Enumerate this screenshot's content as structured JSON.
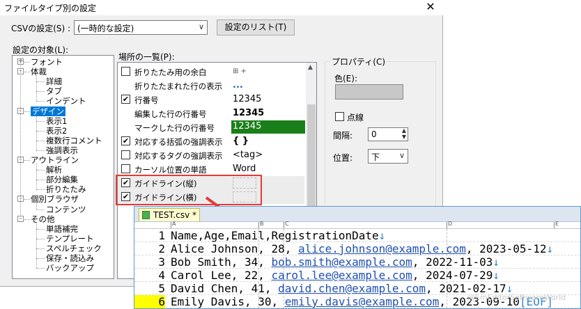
{
  "dialog": {
    "title": "ファイルタイプ別の設定",
    "close_glyph": "✕",
    "csv_settings_label": "CSVの設定(S) :",
    "csv_settings_value": "(一時的な設定)",
    "settings_list_button": "設定のリスト(T)",
    "target_label": "設定の対象(L):",
    "places_label": "場所の一覧(P):",
    "property_label": "プロパティ(C)",
    "color_label": "色(E):",
    "dotted_label": "点線",
    "spacing_label": "間隔:",
    "spacing_value": "0",
    "position_label": "位置:",
    "position_value": "下"
  },
  "tree": [
    {
      "label": "フォント",
      "indent": 0,
      "expander": "+",
      "selected": false
    },
    {
      "label": "体裁",
      "indent": 0,
      "expander": "-",
      "selected": false
    },
    {
      "label": "詳細",
      "indent": 1,
      "expander": "",
      "selected": false
    },
    {
      "label": "タブ",
      "indent": 1,
      "expander": "",
      "selected": false
    },
    {
      "label": "インデント",
      "indent": 1,
      "expander": "",
      "selected": false
    },
    {
      "label": "デザイン",
      "indent": 0,
      "expander": "-",
      "selected": true
    },
    {
      "label": "表示1",
      "indent": 1,
      "expander": "",
      "selected": false
    },
    {
      "label": "表示2",
      "indent": 1,
      "expander": "",
      "selected": false
    },
    {
      "label": "複数行コメント",
      "indent": 1,
      "expander": "",
      "selected": false
    },
    {
      "label": "強調表示",
      "indent": 1,
      "expander": "",
      "selected": false
    },
    {
      "label": "アウトライン",
      "indent": 0,
      "expander": "-",
      "selected": false
    },
    {
      "label": "解析",
      "indent": 1,
      "expander": "",
      "selected": false
    },
    {
      "label": "部分編集",
      "indent": 1,
      "expander": "",
      "selected": false
    },
    {
      "label": "折りたたみ",
      "indent": 1,
      "expander": "",
      "selected": false
    },
    {
      "label": "個別ブラウザ",
      "indent": 0,
      "expander": "-",
      "selected": false
    },
    {
      "label": "コンテンツ",
      "indent": 1,
      "expander": "",
      "selected": false
    },
    {
      "label": "その他",
      "indent": 0,
      "expander": "-",
      "selected": false
    },
    {
      "label": "単語補完",
      "indent": 1,
      "expander": "",
      "selected": false
    },
    {
      "label": "テンプレート",
      "indent": 1,
      "expander": "",
      "selected": false
    },
    {
      "label": "スペルチェック",
      "indent": 1,
      "expander": "",
      "selected": false
    },
    {
      "label": "保存・読込み",
      "indent": 1,
      "expander": "",
      "selected": false
    },
    {
      "label": "バックアップ",
      "indent": 1,
      "expander": "",
      "selected": false
    }
  ],
  "places": [
    {
      "checkbox": true,
      "checked": false,
      "label": "折りたたみ用の余白",
      "sample": "⊞ +",
      "style": "small"
    },
    {
      "checkbox": false,
      "checked": false,
      "label": "折りたたまれた行の表示",
      "sample": "...",
      "style": "dots"
    },
    {
      "checkbox": true,
      "checked": true,
      "label": "行番号",
      "sample": "12345",
      "style": "plain"
    },
    {
      "checkbox": false,
      "checked": false,
      "label": "編集した行の行番号",
      "sample": "12345",
      "style": "bold"
    },
    {
      "checkbox": false,
      "checked": false,
      "label": "マークした行の行番号",
      "sample": "12345",
      "style": "green"
    },
    {
      "checkbox": true,
      "checked": true,
      "label": "対応する括弧の強調表示",
      "sample": "{ }",
      "style": "bold"
    },
    {
      "checkbox": true,
      "checked": false,
      "label": "対応するタグの強調表示",
      "sample": "<tag>",
      "style": "plain"
    },
    {
      "checkbox": true,
      "checked": false,
      "label": "カーソル位置の単語",
      "sample": "Word",
      "style": "plain"
    },
    {
      "checkbox": true,
      "checked": true,
      "label": "ガイドライン(縦)",
      "sample": "",
      "style": "vguide"
    },
    {
      "checkbox": true,
      "checked": true,
      "label": "ガイドライン(横)",
      "sample": "",
      "style": "hguide"
    }
  ],
  "editor": {
    "tab_label": "TEST.csv *",
    "column_letters": [
      "A",
      "B",
      "C",
      "D",
      "E"
    ],
    "lines": [
      {
        "num": "1",
        "name": "Name",
        "age": "Age",
        "email": "Email",
        "date": "RegistrationDate",
        "eol": "↓",
        "current": false
      },
      {
        "num": "2",
        "name": "Alice Johnson",
        "age": "28",
        "email": "alice.johnson@example.com",
        "date": "2023-05-12",
        "eol": "↓",
        "current": false
      },
      {
        "num": "3",
        "name": "Bob Smith",
        "age": "34",
        "email": "bob.smith@example.com",
        "date": "2022-11-03",
        "eol": "↓",
        "current": false
      },
      {
        "num": "4",
        "name": "Carol Lee",
        "age": "22",
        "email": "carol.lee@example.com",
        "date": "2024-07-29",
        "eol": "↓",
        "current": false
      },
      {
        "num": "5",
        "name": "David Chen",
        "age": "41",
        "email": "david.chen@example.com",
        "date": "2021-02-17",
        "eol": "↓",
        "current": false
      },
      {
        "num": "6",
        "name": "Emily Davis",
        "age": "30",
        "email": "emily.davis@example.com",
        "date": "2023-09-10",
        "eol": "[EOF]",
        "current": true
      }
    ],
    "watermark": "@EmEditorSoftwareWorld"
  },
  "colors": {
    "highlight": "#e53935",
    "selection": "#0078d7",
    "marked_line_bg": "#1a7f1a",
    "current_line_num_bg": "#ffff00"
  }
}
